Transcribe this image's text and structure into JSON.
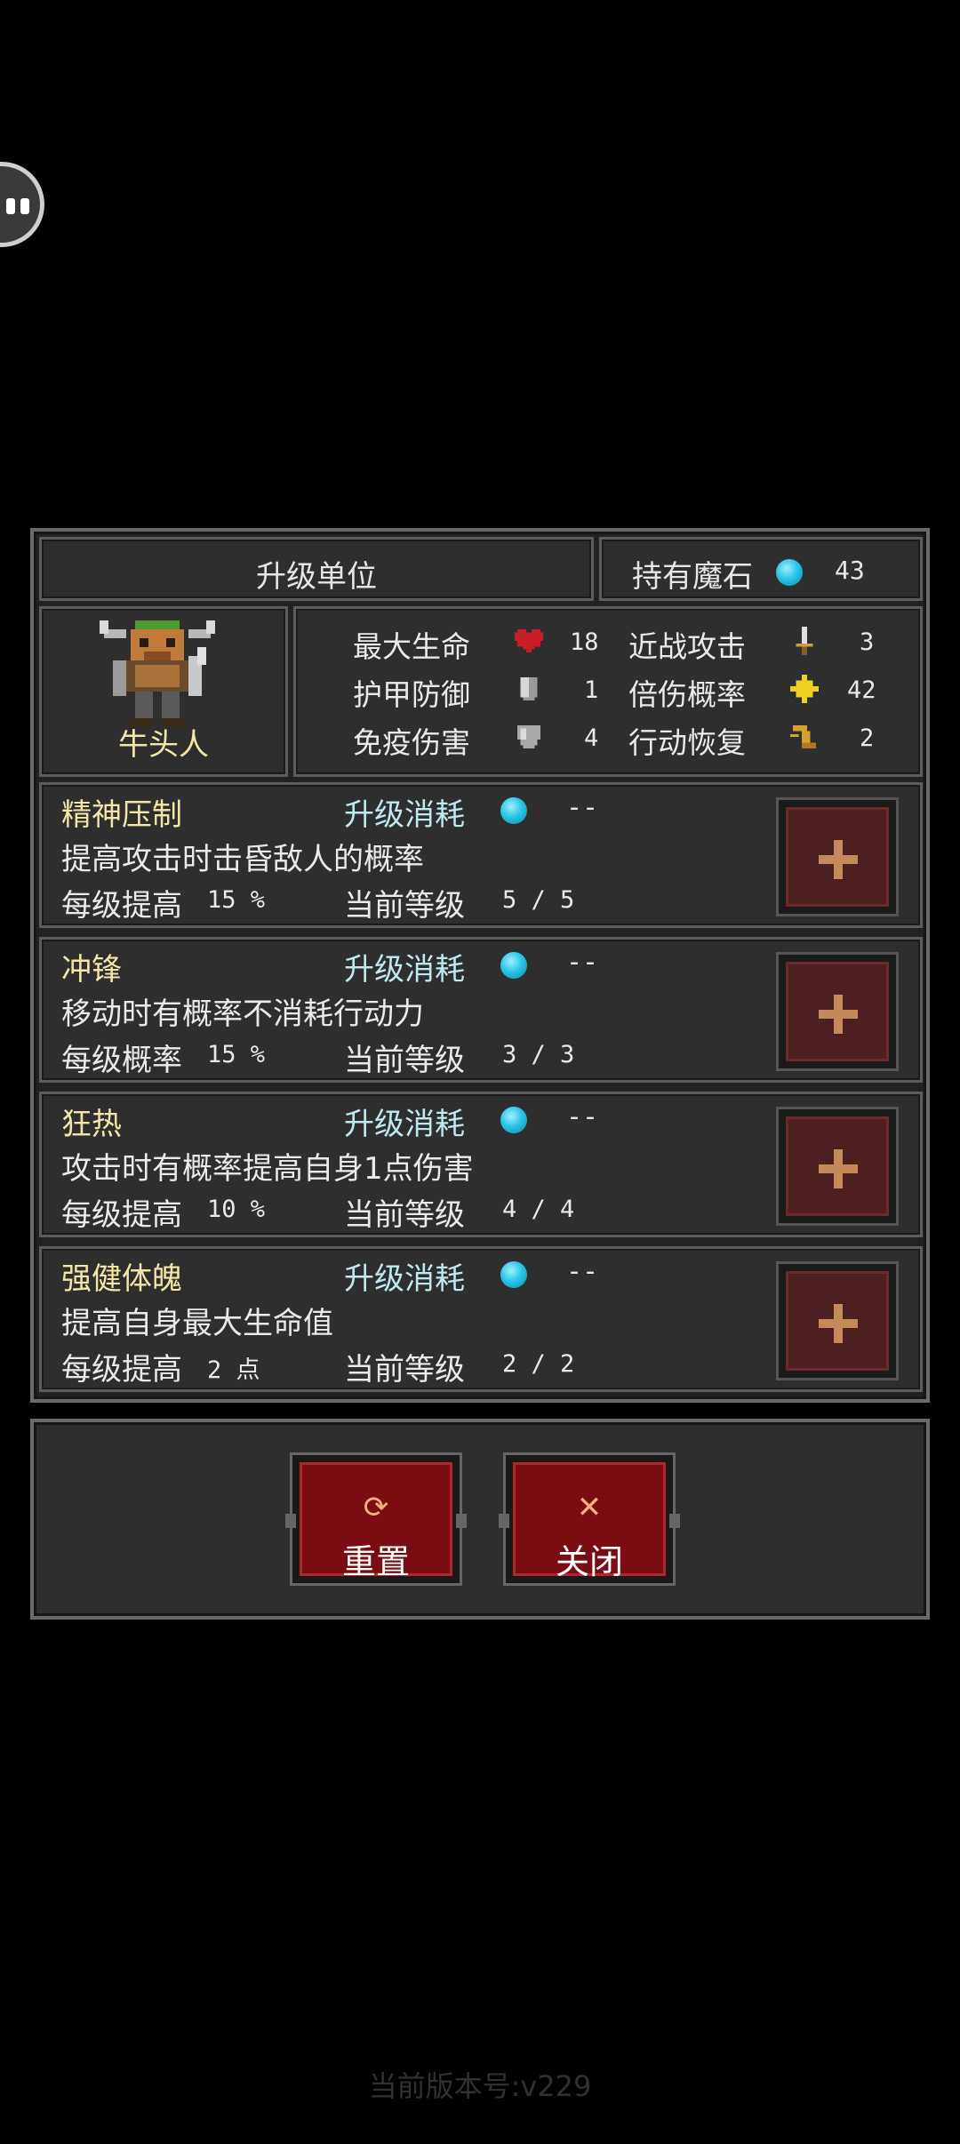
{
  "header": {
    "title": "升级单位",
    "stones_label": "持有魔石",
    "stones_count": "43"
  },
  "unit": {
    "name": "牛头人"
  },
  "stats": [
    {
      "label": "最大生命",
      "value": "18",
      "icon": "heart-icon"
    },
    {
      "label": "护甲防御",
      "value": "1",
      "icon": "armor-icon"
    },
    {
      "label": "免疫伤害",
      "value": "4",
      "icon": "shield-icon"
    },
    {
      "label": "近战攻击",
      "value": "3",
      "icon": "sword-icon"
    },
    {
      "label": "倍伤概率",
      "value": "42",
      "icon": "crit-icon"
    },
    {
      "label": "行动恢复",
      "value": "2",
      "icon": "boot-icon"
    }
  ],
  "skills": [
    {
      "name": "精神压制",
      "cost_label": "升级消耗",
      "cost": "--",
      "desc": "提高攻击时击昏敌人的概率",
      "per_label": "每级提高",
      "per_value": "15 %",
      "level_label": "当前等级",
      "level": "5 / 5"
    },
    {
      "name": "冲锋",
      "cost_label": "升级消耗",
      "cost": "--",
      "desc": "移动时有概率不消耗行动力",
      "per_label": "每级概率",
      "per_value": "15 %",
      "level_label": "当前等级",
      "level": "3 / 3"
    },
    {
      "name": "狂热",
      "cost_label": "升级消耗",
      "cost": "--",
      "desc": "攻击时有概率提高自身1点伤害",
      "per_label": "每级提高",
      "per_value": "10 %",
      "level_label": "当前等级",
      "level": "4 / 4"
    },
    {
      "name": "强健体魄",
      "cost_label": "升级消耗",
      "cost": "--",
      "desc": "提高自身最大生命值",
      "per_label": "每级提高",
      "per_value": "2 点",
      "level_label": "当前等级",
      "level": "2 / 2"
    }
  ],
  "buttons": {
    "reset": "重置",
    "close": "关闭"
  },
  "footer": {
    "version": "当前版本号:v229"
  },
  "colors": {
    "accent_red": "#7a0d12",
    "gem": "#2cc6e6",
    "skill_name": "#f3e6a8"
  }
}
